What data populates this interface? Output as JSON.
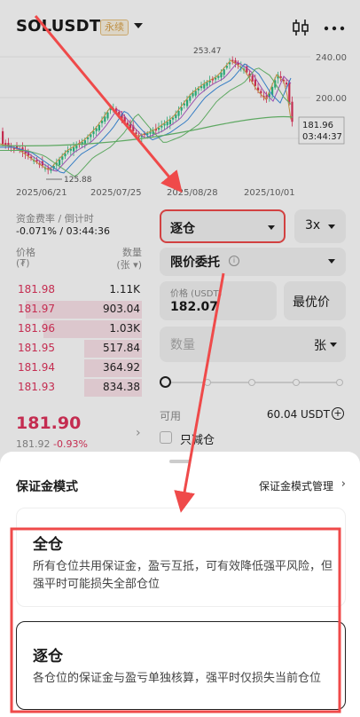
{
  "header": {
    "symbol": "SOLUSDT",
    "badge": "永续",
    "icons": [
      "chevron-down-icon",
      "candlestick-icon",
      "more-icon"
    ]
  },
  "chart": {
    "price_labels": [
      "240.00",
      "200.00"
    ],
    "high_label": "253.47",
    "low_label": "125.88",
    "current_price": "181.96",
    "countdown": "03:44:37",
    "dates": [
      "2025/06/21",
      "2025/07/25",
      "2025/08/28",
      "2025/10/01"
    ]
  },
  "funding": {
    "label": "资金费率 / 倒计时",
    "value": "-0.071% / 03:44:36"
  },
  "orderbook": {
    "price_header": "价格",
    "price_unit": "(₮)",
    "qty_header": "数量",
    "qty_unit": "(张 ▾)",
    "asks": [
      {
        "price": "181.98",
        "qty": "1.11K",
        "depth": 0.0
      },
      {
        "price": "181.97",
        "qty": "903.04",
        "depth": 0.92
      },
      {
        "price": "181.96",
        "qty": "1.03K",
        "depth": 0.78
      },
      {
        "price": "181.95",
        "qty": "517.84",
        "depth": 0.46
      },
      {
        "price": "181.94",
        "qty": "364.92",
        "depth": 0.46
      },
      {
        "price": "181.93",
        "qty": "834.38",
        "depth": 0.46
      }
    ],
    "last_price": "181.90",
    "mark_price": "181.92",
    "change": "-0.93%"
  },
  "form": {
    "margin_mode": "逐仓",
    "leverage": "3x",
    "order_type": "限价委托",
    "price_label": "价格 (USDT)",
    "price_value": "182.07",
    "best_price": "最优价",
    "qty_placeholder": "数量",
    "qty_unit": "张",
    "available_label": "可用",
    "available_value": "60.04 USDT",
    "reduce_only": "只减仓"
  },
  "sheet": {
    "title": "保证金模式",
    "manage_link": "保证金模式管理",
    "options": [
      {
        "name": "全仓",
        "desc": "所有仓位共用保证金，盈亏互抵，可有效降低强平风险，但强平时可能损失全部仓位"
      },
      {
        "name": "逐仓",
        "desc": "各仓位的保证金与盈亏单独核算，强平时仅损失当前仓位"
      }
    ]
  },
  "colors": {
    "down": "#e0335c",
    "annotation": "#ef4a4a",
    "badge": "#d9a24a"
  }
}
